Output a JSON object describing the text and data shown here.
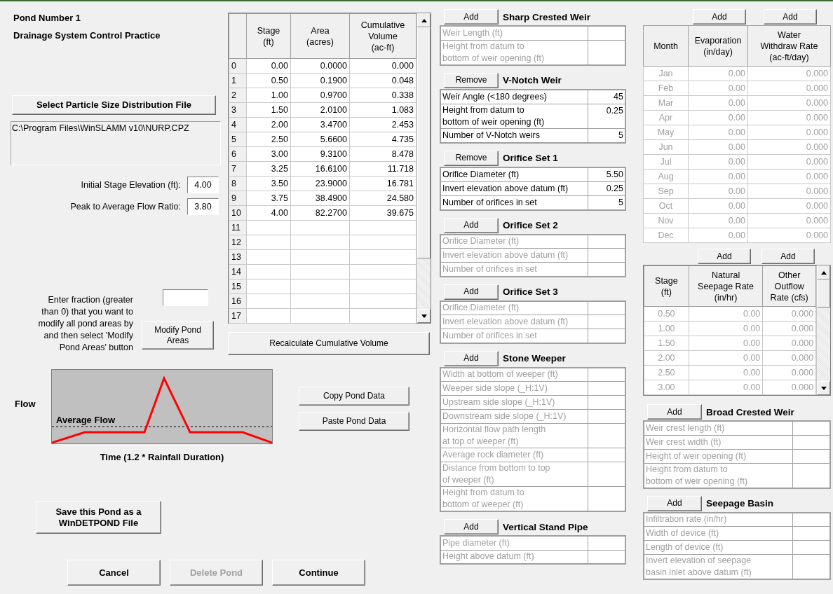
{
  "header": {
    "title": "Pond Number 1",
    "subtitle": "Drainage System Control Practice"
  },
  "particle_file": {
    "button": "Select Particle Size Distribution File",
    "path": "C:\\Program Files\\WinSLAMM v10\\NURP.CPZ"
  },
  "fields": [
    {
      "label": "Initial Stage Elevation (ft):",
      "value": "4.00"
    },
    {
      "label": "Peak to Average Flow Ratio:",
      "value": "3.80"
    }
  ],
  "modify_areas": {
    "instructions": "Enter fraction (greater\nthan 0) that you want to\nmodify all pond areas by\nand then select 'Modify\nPond Areas' button",
    "button": "Modify Pond\nAreas"
  },
  "stage_table": {
    "columns": [
      "Stage\n(ft)",
      "Area\n(acres)",
      "Cumulative\nVolume\n(ac-ft)"
    ],
    "rows": [
      {
        "index": "0",
        "values": [
          "0.00",
          "0.0000",
          "0.000"
        ]
      },
      {
        "index": "1",
        "values": [
          "0.50",
          "0.1900",
          "0.048"
        ]
      },
      {
        "index": "2",
        "values": [
          "1.00",
          "0.9700",
          "0.338"
        ]
      },
      {
        "index": "3",
        "values": [
          "1.50",
          "2.0100",
          "1.083"
        ]
      },
      {
        "index": "4",
        "values": [
          "2.00",
          "3.4700",
          "2.453"
        ]
      },
      {
        "index": "5",
        "values": [
          "2.50",
          "5.6600",
          "4.735"
        ]
      },
      {
        "index": "6",
        "values": [
          "3.00",
          "9.3100",
          "8.478"
        ]
      },
      {
        "index": "7",
        "values": [
          "3.25",
          "16.6100",
          "11.718"
        ]
      },
      {
        "index": "8",
        "values": [
          "3.50",
          "23.9000",
          "16.781"
        ]
      },
      {
        "index": "9",
        "values": [
          "3.75",
          "38.4900",
          "24.580"
        ]
      },
      {
        "index": "10",
        "values": [
          "4.00",
          "82.2700",
          "39.675"
        ]
      },
      {
        "index": "11",
        "values": []
      },
      {
        "index": "12",
        "values": []
      },
      {
        "index": "13",
        "values": []
      },
      {
        "index": "14",
        "values": []
      },
      {
        "index": "15",
        "values": []
      },
      {
        "index": "16",
        "values": []
      },
      {
        "index": "17",
        "values": []
      }
    ],
    "button": "Recalculate Cumulative Volume"
  },
  "flow_chart": {
    "y_label": "Flow",
    "line_label": "Average Flow",
    "x_label": "Time (1.2 * Rainfall Duration)"
  },
  "pond_data_buttons": [
    "Copy Pond Data",
    "Paste Pond Data"
  ],
  "save_button": "Save this Pond as a\nWinDETPOND File",
  "bottom_buttons": [
    {
      "label": "Cancel",
      "disabled": false
    },
    {
      "label": "Delete Pond",
      "disabled": true
    },
    {
      "label": "Continue",
      "disabled": false
    }
  ],
  "devices_left": [
    {
      "button": "Add",
      "title": "Sharp Crested Weir",
      "enabled": false,
      "rows": [
        {
          "label": "Weir Length (ft)"
        },
        {
          "label": "Height from datum to\nbottom of weir opening (ft)"
        }
      ]
    },
    {
      "button": "Remove",
      "title": "V-Notch Weir",
      "enabled": true,
      "rows": [
        {
          "label": "Weir Angle (<180 degrees)",
          "value": "45"
        },
        {
          "label": "Height from datum to\nbottom of weir opening (ft)",
          "value": "0.25"
        },
        {
          "label": "Number of V-Notch weirs",
          "value": "5"
        }
      ]
    },
    {
      "button": "Remove",
      "title": "Orifice Set 1",
      "enabled": true,
      "rows": [
        {
          "label": "Orifice Diameter (ft)",
          "value": "5.50"
        },
        {
          "label": "Invert elevation above datum (ft)",
          "value": "0.25"
        },
        {
          "label": "Number of orifices in set",
          "value": "5"
        }
      ]
    },
    {
      "button": "Add",
      "title": "Orifice Set 2",
      "enabled": false,
      "rows": [
        {
          "label": "Orifice Diameter (ft)"
        },
        {
          "label": "Invert elevation above datum (ft)"
        },
        {
          "label": "Number of orifices in set"
        }
      ]
    },
    {
      "button": "Add",
      "title": "Orifice Set 3",
      "enabled": false,
      "rows": [
        {
          "label": "Orifice Diameter (ft)"
        },
        {
          "label": "Invert elevation above datum (ft)"
        },
        {
          "label": "Number of orifices in set"
        }
      ]
    },
    {
      "button": "Add",
      "title": "Stone Weeper",
      "enabled": false,
      "rows": [
        {
          "label": "Width at bottom of weeper (ft)"
        },
        {
          "label": "Weeper side slope (_H:1V)"
        },
        {
          "label": "Upstream side slope (_H:1V)"
        },
        {
          "label": "Downstream side slope (_H:1V)"
        },
        {
          "label": "Horizontal flow path length\nat top of weeper (ft)"
        },
        {
          "label": "Average rock diameter (ft)"
        },
        {
          "label": "Distance from bottom to top\nof weeper (ft)"
        },
        {
          "label": "Height from datum to\nbottom of weeper (ft)"
        }
      ]
    },
    {
      "button": "Add",
      "title": "Vertical Stand Pipe",
      "enabled": false,
      "rows": [
        {
          "label": "Pipe diameter (ft)"
        },
        {
          "label": "Height above datum (ft)"
        }
      ]
    }
  ],
  "monthly": {
    "buttons": [
      "Add",
      "Add"
    ],
    "enabled": false,
    "columns": [
      "Month",
      "Evaporation\n(in/day)",
      "Water\nWithdraw Rate\n(ac-ft/day)"
    ],
    "rows": [
      [
        "Jan",
        "0.00",
        "0.000"
      ],
      [
        "Feb",
        "0.00",
        "0.000"
      ],
      [
        "Mar",
        "0.00",
        "0.000"
      ],
      [
        "Apr",
        "0.00",
        "0.000"
      ],
      [
        "May",
        "0.00",
        "0.000"
      ],
      [
        "Jun",
        "0.00",
        "0.000"
      ],
      [
        "Jul",
        "0.00",
        "0.000"
      ],
      [
        "Aug",
        "0.00",
        "0.000"
      ],
      [
        "Sep",
        "0.00",
        "0.000"
      ],
      [
        "Oct",
        "0.00",
        "0.000"
      ],
      [
        "Nov",
        "0.00",
        "0.000"
      ],
      [
        "Dec",
        "0.00",
        "0.000"
      ]
    ]
  },
  "seepage": {
    "buttons": [
      "Add",
      "Add"
    ],
    "enabled": false,
    "columns": [
      "Stage\n(ft)",
      "Natural\nSeepage Rate\n(in/hr)",
      "Other\nOutflow\nRate (cfs)"
    ],
    "rows": [
      [
        "0.50",
        "0.00",
        "0.000"
      ],
      [
        "1.00",
        "0.00",
        "0.000"
      ],
      [
        "1.50",
        "0.00",
        "0.000"
      ],
      [
        "2.00",
        "0.00",
        "0.000"
      ],
      [
        "2.50",
        "0.00",
        "0.000"
      ],
      [
        "3.00",
        "0.00",
        "0.000"
      ]
    ]
  },
  "devices_right": [
    {
      "button": "Add",
      "title": "Broad Crested Weir",
      "enabled": false,
      "rows": [
        {
          "label": "Weir crest length (ft)"
        },
        {
          "label": "Weir crest width (ft)"
        },
        {
          "label": "Height of weir opening (ft)"
        },
        {
          "label": "Height from datum to\nbottom of weir opening (ft)"
        }
      ]
    },
    {
      "button": "Add",
      "title": "Seepage Basin",
      "enabled": false,
      "rows": [
        {
          "label": "Infiltration rate (in/hr)"
        },
        {
          "label": "Width of device (ft)"
        },
        {
          "label": "Length of device (ft)"
        },
        {
          "label": "Invert elevation of seepage\nbasin inlet above datum (ft)"
        }
      ]
    }
  ]
}
